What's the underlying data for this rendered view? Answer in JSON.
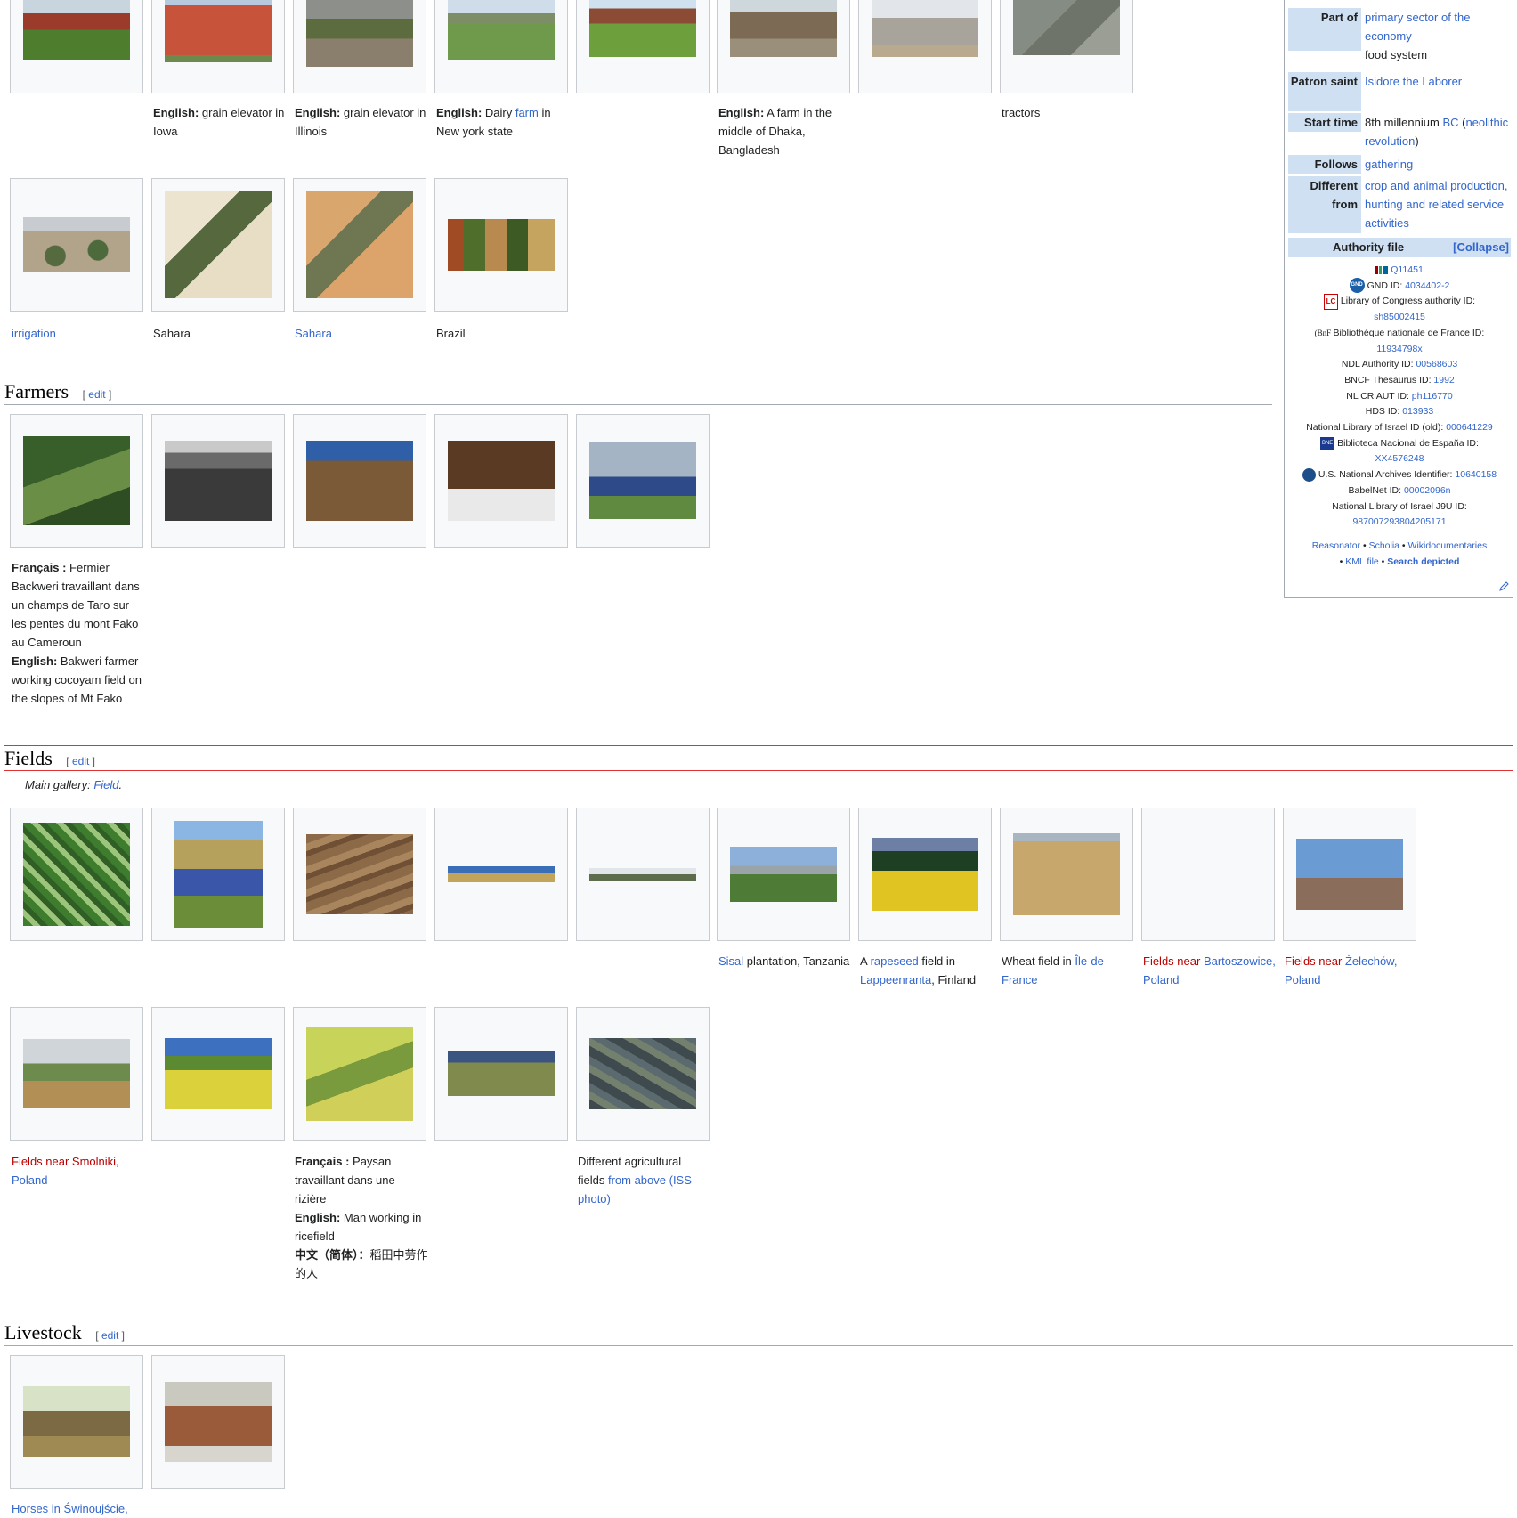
{
  "top_gallery": {
    "row1": [
      {
        "name": "img-farm-animals",
        "caption_html": ""
      },
      {
        "name": "img-grain-elevator-iowa",
        "caption_html": "<b>English:</b> grain elevator in Iowa"
      },
      {
        "name": "img-grain-elevator-illinois",
        "caption_html": "<b>English:</b> grain elevator in Illinois"
      },
      {
        "name": "img-dairy-farm",
        "caption_html": "<b>English:</b> Dairy <span class=\"link\">farm</span> in New york state"
      },
      {
        "name": "img-farmhouse",
        "caption_html": ""
      },
      {
        "name": "img-dhaka-farm",
        "caption_html": "<b>English:</b> A farm in the middle of Dhaka, Bangladesh"
      },
      {
        "name": "img-round-barn",
        "caption_html": ""
      },
      {
        "name": "img-tractors",
        "caption_html": "tractors"
      }
    ],
    "row2": [
      {
        "name": "img-irrigation",
        "caption_html": "<span class=\"link\">irrigation</span>"
      },
      {
        "name": "img-sahara-1",
        "caption_html": "Sahara"
      },
      {
        "name": "img-sahara-2",
        "caption_html": "<span class=\"link\">Sahara</span>"
      },
      {
        "name": "img-brazil",
        "caption_html": "Brazil"
      }
    ]
  },
  "sections": {
    "farmers": {
      "title": "Farmers",
      "edit": "edit"
    },
    "fields": {
      "title": "Fields",
      "edit": "edit",
      "main_gallery_label": "Main gallery:",
      "main_gallery_link": "Field"
    },
    "livestock": {
      "title": "Livestock",
      "edit": "edit"
    }
  },
  "farmers_gallery": [
    {
      "name": "img-bakweri-farmer",
      "caption_html": "<b>Français :</b> Fermier Backweri travaillant dans un champs de Taro sur les pentes du mont Fako au Cameroun<br><b>English:</b> Bakweri farmer working cocoyam field on the slopes of Mt Fako"
    },
    {
      "name": "img-plowed-field",
      "caption_html": ""
    },
    {
      "name": "img-smiling-farmer",
      "caption_html": ""
    },
    {
      "name": "img-child-seeds",
      "caption_html": ""
    },
    {
      "name": "img-farmers-tractor",
      "caption_html": ""
    }
  ],
  "fields_gallery": {
    "row1": [
      {
        "name": "img-aerial-fields",
        "caption_html": ""
      },
      {
        "name": "img-flower-field",
        "caption_html": ""
      },
      {
        "name": "img-dry-field",
        "caption_html": ""
      },
      {
        "name": "img-panorama-1",
        "caption_html": ""
      },
      {
        "name": "img-panorama-2",
        "caption_html": ""
      },
      {
        "name": "img-sisal",
        "caption_html": "<span class=\"link\">Sisal</span> plantation, Tanzania"
      },
      {
        "name": "img-rapeseed",
        "caption_html": "A <span class=\"link\">rapeseed</span> field in <span class=\"link\">Lappeenranta</span>, Finland"
      },
      {
        "name": "img-wheat",
        "caption_html": "Wheat field in <span class=\"link\">Île-de-France</span>"
      },
      {
        "name": "img-bartoszowice",
        "caption_html": "<span class=\"red\">Fields near</span> <span class=\"link\">Bartoszowice, Poland</span>"
      },
      {
        "name": "img-zelechow",
        "caption_html": "<span class=\"red\">Fields near</span> <span class=\"link\">Żelechów, Poland</span>"
      }
    ],
    "row2": [
      {
        "name": "img-smolniki",
        "caption_html": "<span class=\"red\">Fields near Smolniki,</span> <span class=\"link\">Poland</span>"
      },
      {
        "name": "img-yellow-field",
        "caption_html": ""
      },
      {
        "name": "img-ricefield",
        "caption_html": "<b>Français :</b> Paysan travaillant dans une rizière<br><b>English:</b> Man working in ricefield<br><b>中文（简体）：</b>稻田中劳作的人"
      },
      {
        "name": "img-hay-bales",
        "caption_html": ""
      },
      {
        "name": "img-iss-fields",
        "caption_html": "Different agricultural fields <span class=\"link\">from above (ISS photo)</span>"
      }
    ]
  },
  "livestock_gallery": [
    {
      "name": "img-horses",
      "caption_html": "<span class=\"link\">Horses in Świnoujście,</span>"
    },
    {
      "name": "img-goat",
      "caption_html": ""
    }
  ],
  "infobox": {
    "rows": [
      {
        "label": "Part of",
        "value_html": "<span class=\"link\">primary sector of the economy</span><br>food system"
      },
      {
        "label": "Patron saint",
        "value_html": "<span class=\"link\">Isidore the Laborer</span>"
      },
      {
        "label": "Start time",
        "value_html": "8th millennium <span class=\"link\">BC</span> (<span class=\"link\">neolithic revolution</span>)"
      },
      {
        "label": "Follows",
        "value_html": "<span class=\"link\">gathering</span>"
      },
      {
        "label": "Different from",
        "value_html": "<span class=\"link\">crop and animal production, hunting and related service activities</span>"
      }
    ],
    "authority_title": "Authority file",
    "collapse": "[Collapse]",
    "authority_html": [
      "<span class=\"ico\" style=\"width:14px;height:9px;background:linear-gradient(90deg,#990000 0 20%,#fff 20% 30%,#339966 30% 50%,#fff 50% 60%,#006699 60% 100%)\"></span><span class=\"link\">Q11451</span>",
      "<span class=\"ico\" style=\"width:17px;height:17px;border-radius:50%;background:#1a5fa8;color:#fff;font-size:6px;line-height:17px;font-weight:bold\">GND</span>GND ID: <span class=\"link\">4034402-2</span>",
      "<span class=\"ico\" style=\"width:14px;height:16px;border:1px solid #c00;color:#c00;font-size:8px;line-height:16px;font-weight:bold\">LC</span>Library of Congress authority ID:",
      "<span class=\"link\">sh85002415</span>",
      "<span style=\"font-family:serif;font-size:9px\">(BnF </span>Bibliothèque nationale de France ID:",
      "<span class=\"link\">11934798x</span>",
      "NDL Authority ID: <span class=\"link\">00568603</span>",
      "BNCF Thesaurus ID: <span class=\"link\">1992</span>",
      "NL CR AUT ID: <span class=\"link\">ph116770</span>",
      "HDS ID: <span class=\"link\">013933</span>",
      "National Library of Israel ID (old): <span class=\"link\">000641229</span>",
      "<span class=\"ico\" style=\"width:16px;height:14px;background:#1a3a8f;color:#fff;font-size:6px;line-height:14px\">BNE</span>Biblioteca Nacional de España ID:",
      "<span class=\"link\">XX4576248</span>",
      "<span class=\"ico\" style=\"width:15px;height:15px;border-radius:50%;background:#1c4f8a\"></span>U.S. National Archives Identifier: <span class=\"link\">10640158</span>",
      "BabelNet ID: <span class=\"link\">00002096n</span>",
      "National Library of Israel J9U ID:",
      "<span class=\"link\">987007293804205171</span>",
      "<span class=\"link\">Reasonator</span> • <span class=\"link\">Scholia</span> • <span class=\"link\">Wikidocumentaries</span>",
      "• <span class=\"link\">KML file</span> • <span class=\"link\" style=\"font-weight:bold\">Search depicted</span>"
    ],
    "pencil_icon": "pencil-icon"
  },
  "colors": {
    "link": "#3366cc",
    "redlink": "#ba0000",
    "infobox_label_bg": "#cee0f2",
    "gallery_bg": "#f8f9fa"
  }
}
